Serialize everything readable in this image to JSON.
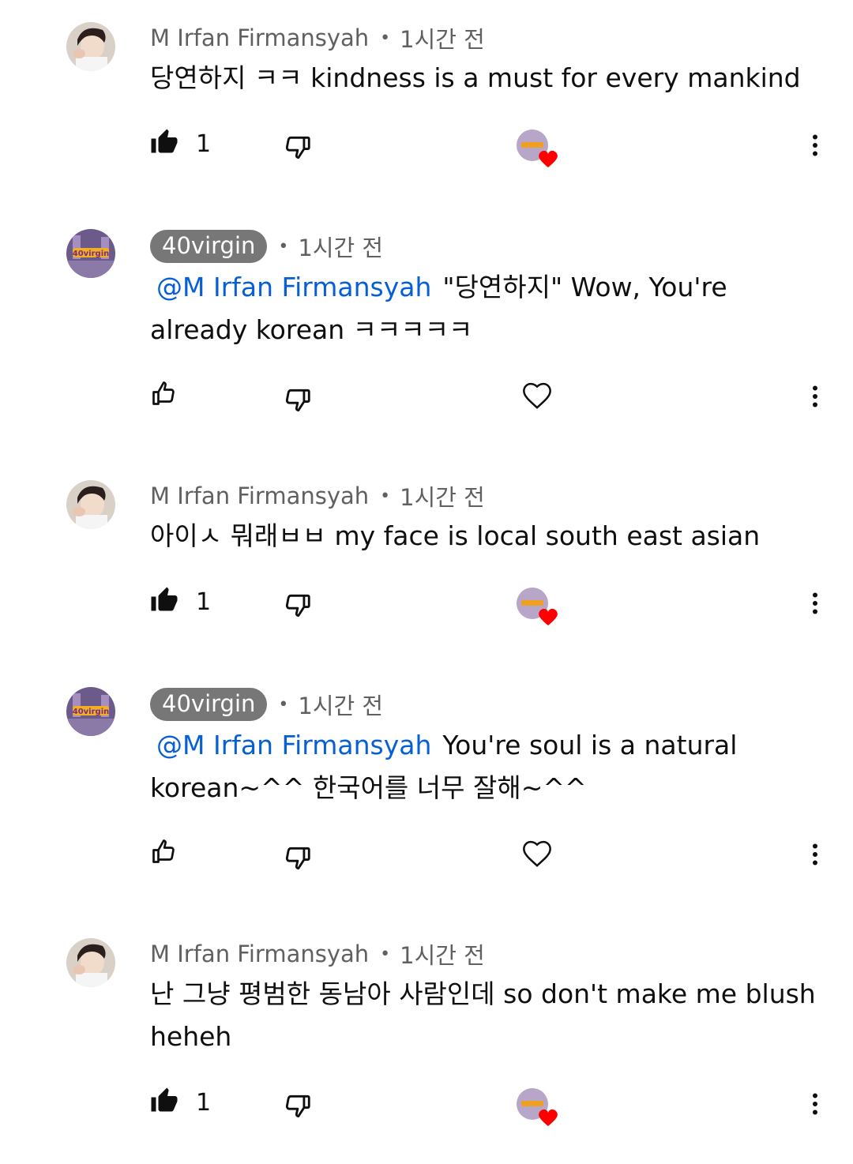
{
  "comments": [
    {
      "author": "M Irfan Firmansyah",
      "author_style": "plain",
      "avatar": "photo-avatar",
      "separator": "•",
      "time": "1시간 전",
      "mention": "",
      "text": "당연하지 ㅋㅋ kindness is a must for every mankind",
      "like_count": "1",
      "liked": true,
      "creator_heart": true
    },
    {
      "author": "40virgin",
      "author_style": "chip",
      "avatar": "channel-avatar",
      "separator": "•",
      "time": "1시간 전",
      "mention": "@M Irfan Firmansyah",
      "text": "\"당연하지\" Wow, You're already korean ㅋㅋㅋㅋㅋ",
      "like_count": "",
      "liked": false,
      "creator_heart": false
    },
    {
      "author": "M Irfan Firmansyah",
      "author_style": "plain",
      "avatar": "photo-avatar",
      "separator": "•",
      "time": "1시간 전",
      "mention": "",
      "text": "아이ㅅ 뭐래ㅂㅂ my face is local south east asian",
      "like_count": "1",
      "liked": true,
      "creator_heart": true
    },
    {
      "author": "40virgin",
      "author_style": "chip",
      "avatar": "channel-avatar",
      "separator": "•",
      "time": "1시간 전",
      "mention": "@M Irfan Firmansyah",
      "text": "You're soul is a natural korean~^^ 한국어를 너무 잘해~^^",
      "like_count": "",
      "liked": false,
      "creator_heart": false
    },
    {
      "author": "M Irfan Firmansyah",
      "author_style": "plain",
      "avatar": "photo-avatar",
      "separator": "•",
      "time": "1시간 전",
      "mention": "",
      "text": "난 그냥 평범한 동남아 사람인데 so don't make me blush heheh",
      "like_count": "1",
      "liked": true,
      "creator_heart": true
    }
  ],
  "colors": {
    "mention": "#065fd4",
    "meta": "#606060",
    "chip_bg": "#777777",
    "heart_red": "#ff0000"
  }
}
